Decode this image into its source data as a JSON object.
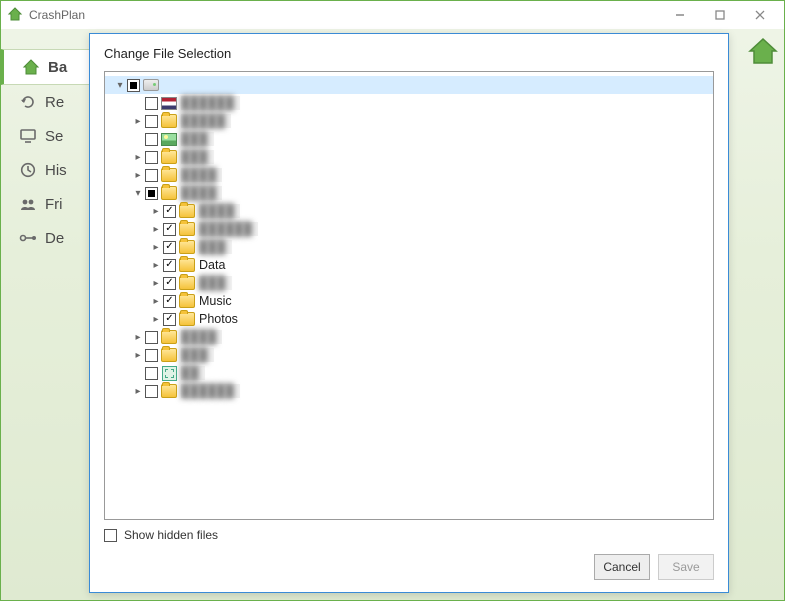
{
  "app": {
    "title": "CrashPlan"
  },
  "sidebar": {
    "items": [
      {
        "label": "Ba"
      },
      {
        "label": "Re"
      },
      {
        "label": "Se"
      },
      {
        "label": "His"
      },
      {
        "label": "Fri"
      },
      {
        "label": "De"
      }
    ]
  },
  "dialog": {
    "title": "Change File Selection",
    "show_hidden_label": "Show hidden files",
    "buttons": {
      "cancel": "Cancel",
      "save": "Save"
    }
  },
  "tree": [
    {
      "depth": 0,
      "expander": "open",
      "check": "mixed",
      "icon": "drive",
      "label": "",
      "blur": false,
      "selected": true
    },
    {
      "depth": 1,
      "expander": "none",
      "check": "unchecked",
      "icon": "flag",
      "label": "██████",
      "blur": true
    },
    {
      "depth": 1,
      "expander": "closed",
      "check": "unchecked",
      "icon": "folder",
      "label": "█████",
      "blur": true
    },
    {
      "depth": 1,
      "expander": "none",
      "check": "unchecked",
      "icon": "img",
      "label": "███",
      "blur": true
    },
    {
      "depth": 1,
      "expander": "closed",
      "check": "unchecked",
      "icon": "folder",
      "label": "███",
      "blur": true
    },
    {
      "depth": 1,
      "expander": "closed",
      "check": "unchecked",
      "icon": "folder",
      "label": "████",
      "blur": true
    },
    {
      "depth": 1,
      "expander": "open",
      "check": "mixed",
      "icon": "folder",
      "label": "████",
      "blur": true
    },
    {
      "depth": 2,
      "expander": "closed",
      "check": "checked",
      "icon": "folder",
      "label": "████",
      "blur": true
    },
    {
      "depth": 2,
      "expander": "closed",
      "check": "checked",
      "icon": "folder",
      "label": "██████",
      "blur": true
    },
    {
      "depth": 2,
      "expander": "closed",
      "check": "checked",
      "icon": "folder",
      "label": "███",
      "blur": true
    },
    {
      "depth": 2,
      "expander": "closed",
      "check": "checked",
      "icon": "folder",
      "label": "Data",
      "blur": false
    },
    {
      "depth": 2,
      "expander": "closed",
      "check": "checked",
      "icon": "folder",
      "label": "███",
      "blur": true
    },
    {
      "depth": 2,
      "expander": "closed",
      "check": "checked",
      "icon": "folder",
      "label": "Music",
      "blur": false
    },
    {
      "depth": 2,
      "expander": "closed",
      "check": "checked",
      "icon": "folder",
      "label": "Photos",
      "blur": false
    },
    {
      "depth": 1,
      "expander": "closed",
      "check": "unchecked",
      "icon": "folder",
      "label": "████",
      "blur": true
    },
    {
      "depth": 1,
      "expander": "closed",
      "check": "unchecked",
      "icon": "folder",
      "label": "███",
      "blur": true
    },
    {
      "depth": 1,
      "expander": "none",
      "check": "unchecked",
      "icon": "sys",
      "label": "██",
      "blur": true
    },
    {
      "depth": 1,
      "expander": "closed",
      "check": "unchecked",
      "icon": "folder",
      "label": "██████",
      "blur": true
    }
  ]
}
